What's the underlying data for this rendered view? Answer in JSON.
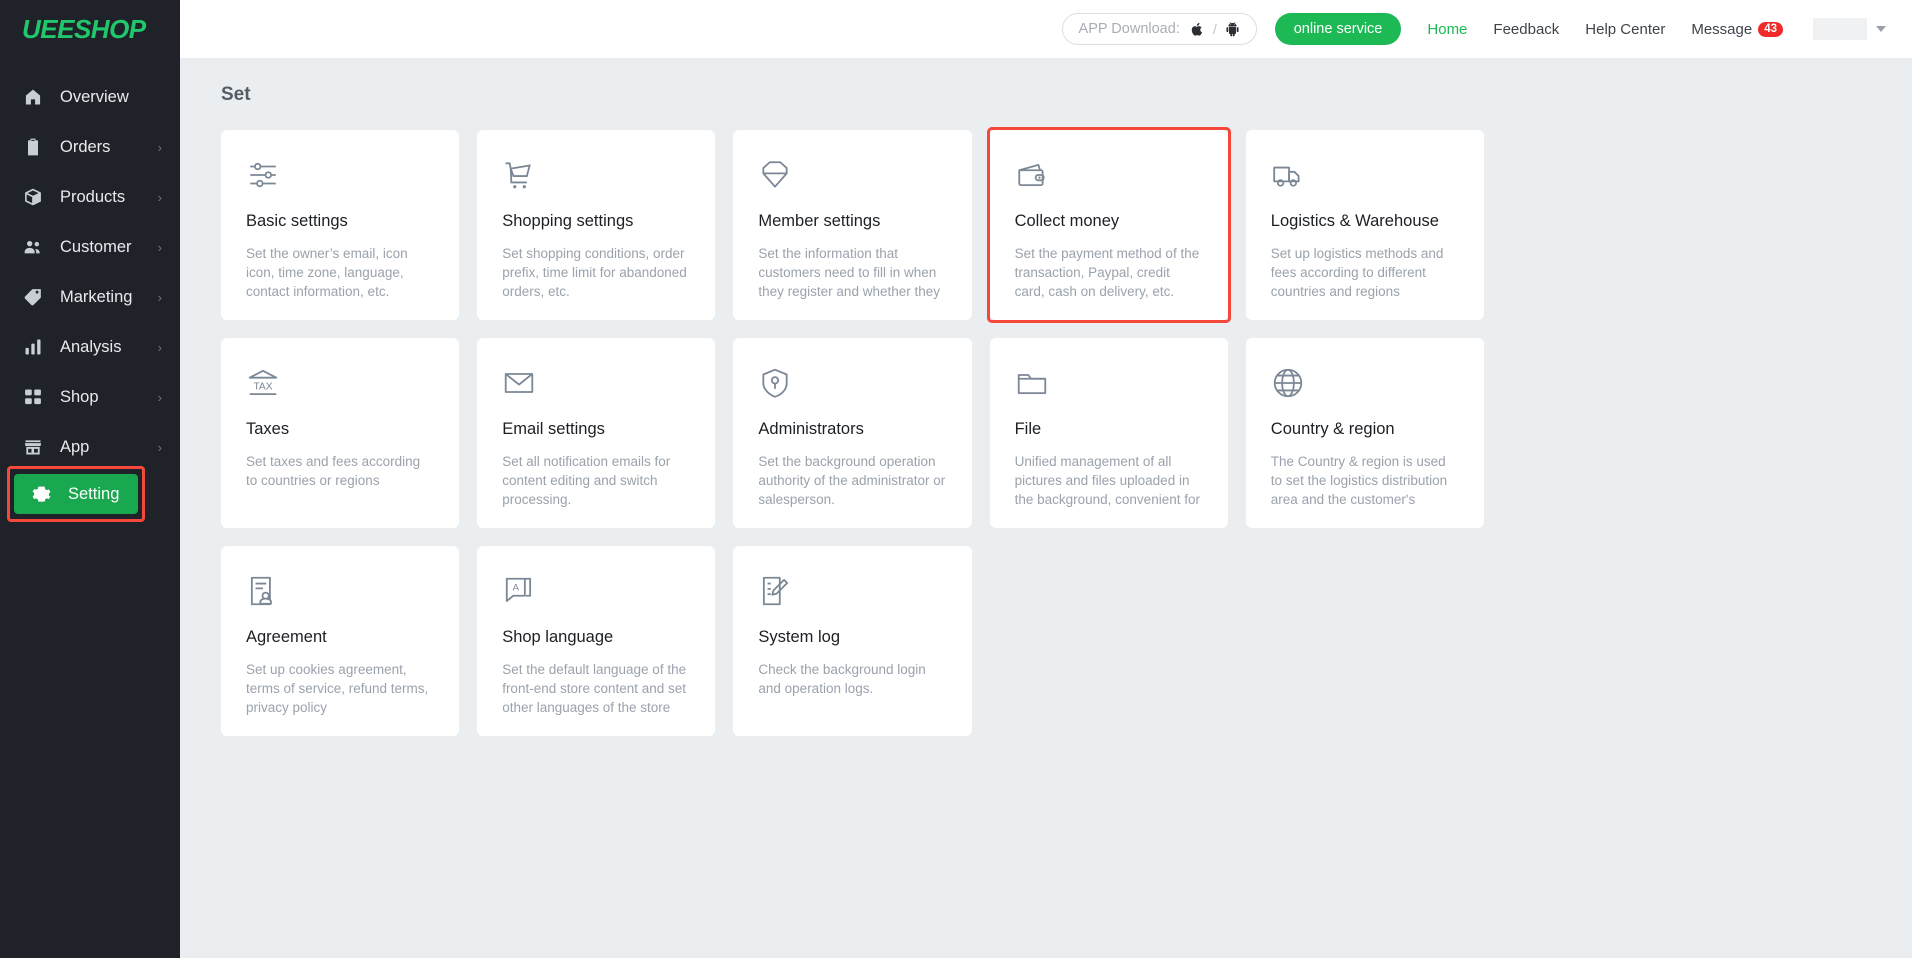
{
  "brand": {
    "name": "UEESHOP",
    "color": "#20c86b"
  },
  "sidebar": {
    "items": [
      {
        "label": "Overview",
        "icon": "home-icon",
        "chevron": ""
      },
      {
        "label": "Orders",
        "icon": "clipboard-icon",
        "chevron": "›"
      },
      {
        "label": "Products",
        "icon": "box-icon",
        "chevron": "›"
      },
      {
        "label": "Customer",
        "icon": "users-icon",
        "chevron": "›"
      },
      {
        "label": "Marketing",
        "icon": "tag-icon",
        "chevron": "›"
      },
      {
        "label": "Analysis",
        "icon": "bar-chart-icon",
        "chevron": "›"
      },
      {
        "label": "Shop",
        "icon": "grid-icon",
        "chevron": "›"
      },
      {
        "label": "App",
        "icon": "storefront-icon",
        "chevron": "›"
      }
    ],
    "active": {
      "label": "Setting",
      "icon": "gear-icon",
      "color": "#19a84f",
      "highlight_color": "#f4483b"
    }
  },
  "topbar": {
    "app_download_label": "APP Download:",
    "app_download_separator": "/",
    "online_service": "online service",
    "links": [
      {
        "label": "Home",
        "accent": true
      },
      {
        "label": "Feedback",
        "accent": false
      },
      {
        "label": "Help Center",
        "accent": false
      }
    ],
    "message": {
      "label": "Message",
      "count": "43",
      "badge_color": "#f02a2a"
    }
  },
  "main": {
    "page_title": "Set",
    "cards": [
      {
        "icon": "sliders-icon",
        "title": "Basic settings",
        "desc": "Set the owner’s email, icon icon, time zone, language, contact information, etc.",
        "highlighted": false
      },
      {
        "icon": "shopping-cart-icon",
        "title": "Shopping settings",
        "desc": "Set shopping conditions, order prefix, time limit for abandoned orders, etc.",
        "highlighted": false
      },
      {
        "icon": "diamond-icon",
        "title": "Member settings",
        "desc": "Set the information that customers need to fill in when they register and whether they",
        "highlighted": false
      },
      {
        "icon": "wallet-icon",
        "title": "Collect money",
        "desc": "Set the payment method of the transaction, Paypal, credit card, cash on delivery, etc.",
        "highlighted": true
      },
      {
        "icon": "truck-icon",
        "title": "Logistics & Warehouse",
        "desc": "Set up logistics methods and fees according to different countries and regions",
        "highlighted": false
      },
      {
        "icon": "tax-bank-icon",
        "title": "Taxes",
        "desc": "Set taxes and fees according to countries or regions",
        "highlighted": false
      },
      {
        "icon": "envelope-icon",
        "title": "Email settings",
        "desc": "Set all notification emails for content editing and switch processing.",
        "highlighted": false
      },
      {
        "icon": "shield-key-icon",
        "title": "Administrators",
        "desc": "Set the background operation authority of the administrator or salesperson.",
        "highlighted": false
      },
      {
        "icon": "folder-icon",
        "title": "File",
        "desc": "Unified management of all pictures and files uploaded in the background, convenient for",
        "highlighted": false
      },
      {
        "icon": "globe-icon",
        "title": "Country & region",
        "desc": "The Country & region is used to set the logistics distribution area and the customer's",
        "highlighted": false
      },
      {
        "icon": "document-person-icon",
        "title": "Agreement",
        "desc": "Set up cookies agreement, terms of service, refund terms, privacy policy",
        "highlighted": false
      },
      {
        "icon": "language-icon",
        "title": "Shop language",
        "desc": "Set the default language of the front-end store content and set other languages of the store",
        "highlighted": false
      },
      {
        "icon": "note-pencil-icon",
        "title": "System log",
        "desc": "Check the background login and operation logs.",
        "highlighted": false
      }
    ]
  }
}
